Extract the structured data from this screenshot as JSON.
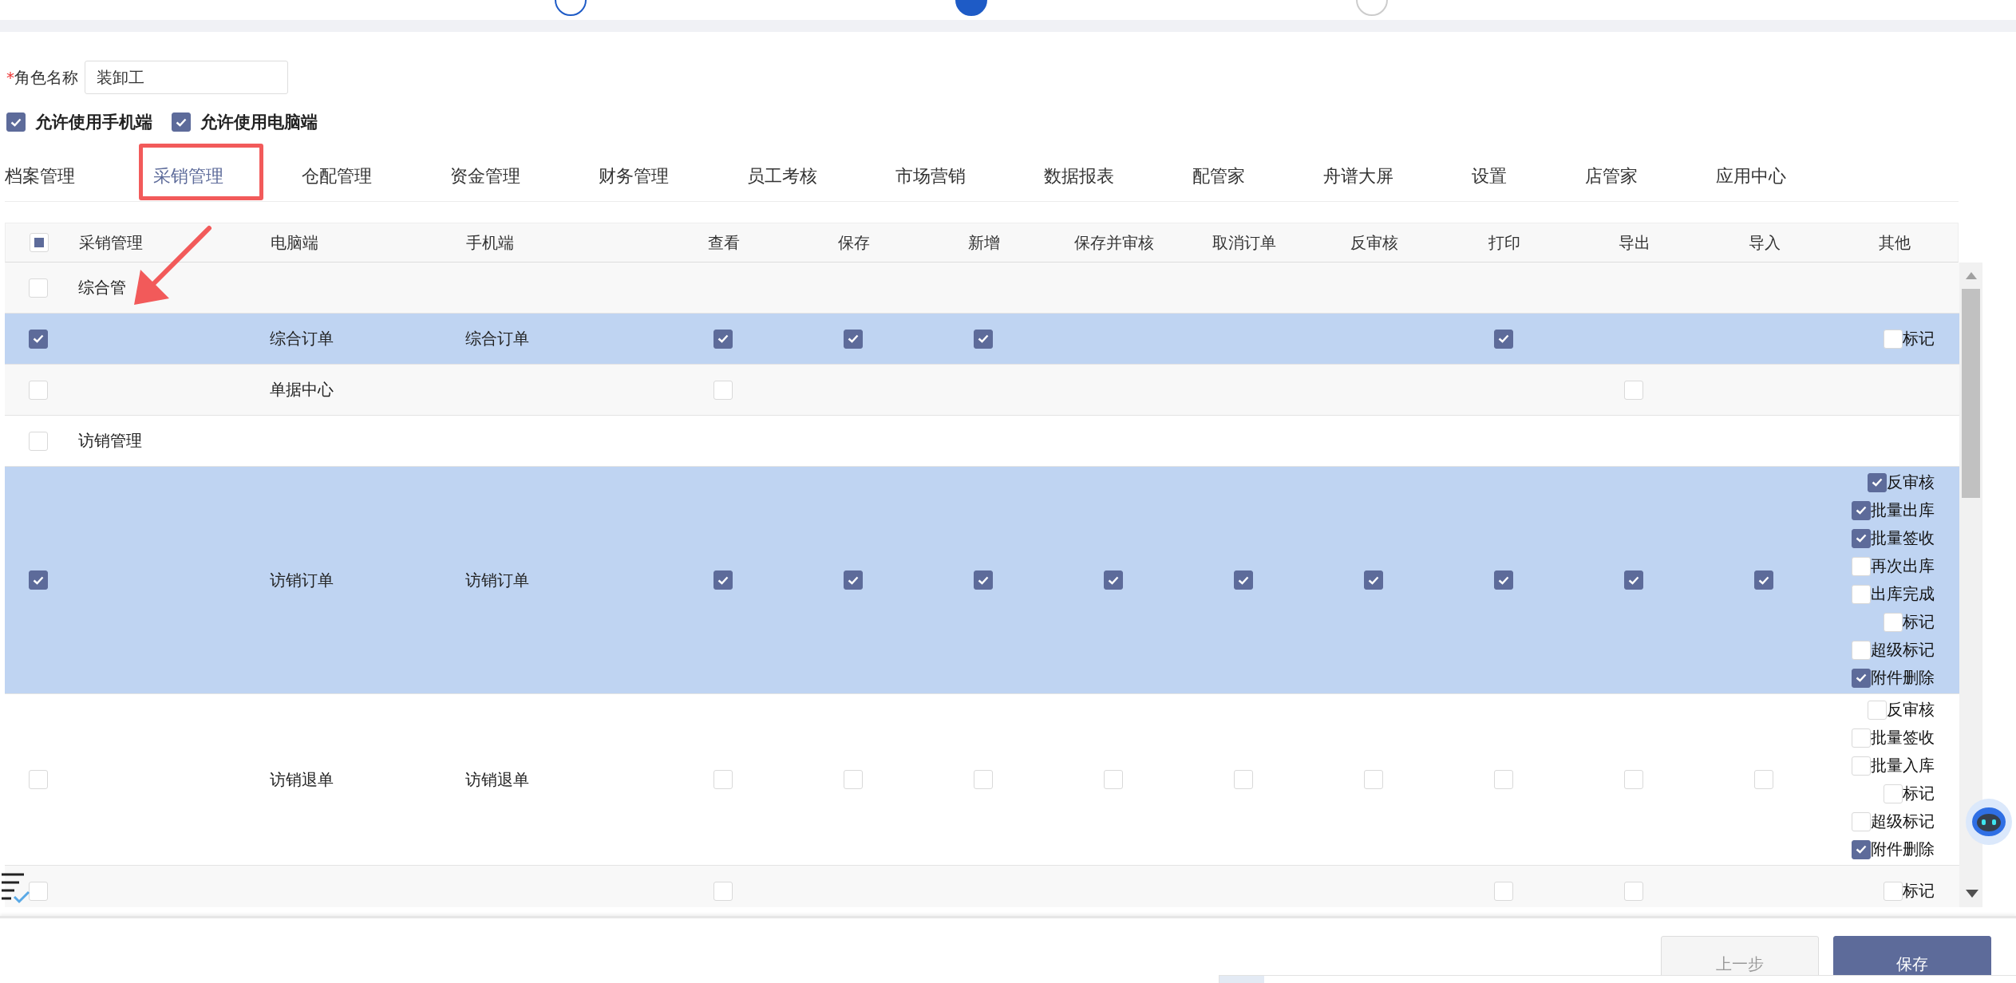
{
  "steps": [
    {
      "kind": "done"
    },
    {
      "kind": "current"
    },
    {
      "kind": "todo"
    }
  ],
  "role_name": {
    "required_mark": "*",
    "label": "角色名称",
    "value": "装卸工"
  },
  "permissions": [
    {
      "label": "允许使用手机端",
      "checked": true
    },
    {
      "label": "允许使用电脑端",
      "checked": true
    }
  ],
  "tabs": [
    {
      "label": "档案管理",
      "selected": false
    },
    {
      "label": "采销管理",
      "selected": true
    },
    {
      "label": "仓配管理",
      "selected": false
    },
    {
      "label": "资金管理",
      "selected": false
    },
    {
      "label": "财务管理",
      "selected": false
    },
    {
      "label": "员工考核",
      "selected": false
    },
    {
      "label": "市场营销",
      "selected": false
    },
    {
      "label": "数据报表",
      "selected": false
    },
    {
      "label": "配管家",
      "selected": false
    },
    {
      "label": "舟谱大屏",
      "selected": false
    },
    {
      "label": "设置",
      "selected": false
    },
    {
      "label": "店管家",
      "selected": false
    },
    {
      "label": "应用中心",
      "selected": false
    }
  ],
  "table": {
    "select_all": {
      "checked": false,
      "indeterminate": true
    },
    "columns": [
      "采销管理",
      "电脑端",
      "手机端",
      "查看",
      "保存",
      "新增",
      "保存并审核",
      "取消订单",
      "反审核",
      "打印",
      "导出",
      "导入",
      "其他"
    ],
    "rows": [
      {
        "kind": "group",
        "selected": false,
        "checked": false,
        "name": "综合管"
      },
      {
        "kind": "item",
        "selected": true,
        "checked": true,
        "pc": "综合订单",
        "mobile": "综合订单",
        "perms": [
          {
            "kind": "check",
            "checked": true
          },
          {
            "kind": "check",
            "checked": true
          },
          {
            "kind": "check",
            "checked": true
          },
          {
            "kind": "blank"
          },
          {
            "kind": "blank"
          },
          {
            "kind": "blank"
          },
          {
            "kind": "check",
            "checked": true
          },
          {
            "kind": "blank"
          },
          {
            "kind": "blank"
          }
        ],
        "other": [
          {
            "label": "标记",
            "checked": false
          }
        ]
      },
      {
        "kind": "item",
        "selected": false,
        "checked": false,
        "pc": "单据中心",
        "perms": [
          {
            "kind": "check",
            "checked": false
          },
          {
            "kind": "blank"
          },
          {
            "kind": "blank"
          },
          {
            "kind": "blank"
          },
          {
            "kind": "blank"
          },
          {
            "kind": "blank"
          },
          {
            "kind": "blank"
          },
          {
            "kind": "check",
            "checked": false
          },
          {
            "kind": "blank"
          }
        ]
      },
      {
        "kind": "group",
        "selected": false,
        "checked": false,
        "name": "访销管理"
      },
      {
        "kind": "item",
        "selected": true,
        "checked": true,
        "pc": "访销订单",
        "mobile": "访销订单",
        "perms": [
          {
            "kind": "check",
            "checked": true
          },
          {
            "kind": "check",
            "checked": true
          },
          {
            "kind": "check",
            "checked": true
          },
          {
            "kind": "check",
            "checked": true
          },
          {
            "kind": "check",
            "checked": true
          },
          {
            "kind": "check",
            "checked": true
          },
          {
            "kind": "check",
            "checked": true
          },
          {
            "kind": "check",
            "checked": true
          },
          {
            "kind": "check",
            "checked": true
          }
        ],
        "other": [
          {
            "label": "反审核",
            "checked": true
          },
          {
            "label": "批量出库",
            "checked": true
          },
          {
            "label": "批量签收",
            "checked": true
          },
          {
            "label": "再次出库",
            "checked": false
          },
          {
            "label": "出库完成",
            "checked": false
          },
          {
            "label": "标记",
            "checked": false
          },
          {
            "label": "超级标记",
            "checked": false
          },
          {
            "label": "附件删除",
            "checked": true
          }
        ]
      },
      {
        "kind": "item",
        "selected": false,
        "checked": false,
        "pc": "访销退单",
        "mobile": "访销退单",
        "perms": [
          {
            "kind": "check",
            "checked": false
          },
          {
            "kind": "check",
            "checked": false
          },
          {
            "kind": "check",
            "checked": false
          },
          {
            "kind": "check",
            "checked": false
          },
          {
            "kind": "check",
            "checked": false
          },
          {
            "kind": "check",
            "checked": false
          },
          {
            "kind": "check",
            "checked": false
          },
          {
            "kind": "check",
            "checked": false
          },
          {
            "kind": "check",
            "checked": false
          }
        ],
        "other": [
          {
            "label": "反审核",
            "checked": false
          },
          {
            "label": "批量签收",
            "checked": false
          },
          {
            "label": "批量入库",
            "checked": false
          },
          {
            "label": "标记",
            "checked": false
          },
          {
            "label": "超级标记",
            "checked": false
          },
          {
            "label": "附件删除",
            "checked": true
          }
        ]
      },
      {
        "kind": "item",
        "selected": false,
        "checked": false,
        "perms": [
          {
            "kind": "check",
            "checked": false
          },
          {
            "kind": "blank"
          },
          {
            "kind": "blank"
          },
          {
            "kind": "blank"
          },
          {
            "kind": "blank"
          },
          {
            "kind": "blank"
          },
          {
            "kind": "check",
            "checked": false
          },
          {
            "kind": "check",
            "checked": false
          },
          {
            "kind": "blank"
          }
        ],
        "other": [
          {
            "label": "标记",
            "checked": false
          }
        ]
      }
    ]
  },
  "buttons": [
    {
      "label": "上一步",
      "disabled": true
    },
    {
      "label": "保存",
      "disabled": false
    }
  ]
}
